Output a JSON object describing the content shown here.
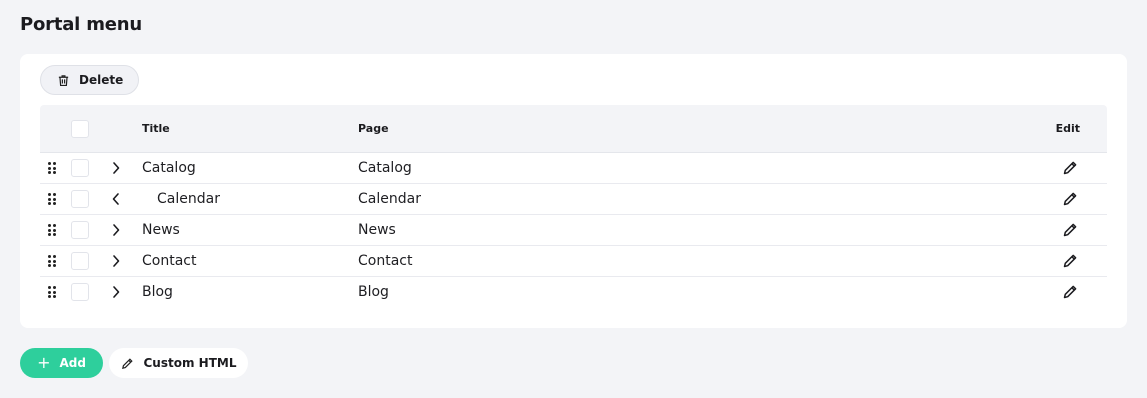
{
  "page": {
    "title": "Portal menu"
  },
  "toolbar": {
    "delete_label": "Delete",
    "delete_icon": "trash-icon"
  },
  "table": {
    "headers": {
      "title": "Title",
      "page": "Page",
      "edit": "Edit"
    },
    "rows": [
      {
        "title": "Catalog",
        "page": "Catalog",
        "chevron": "chevron-right-icon",
        "indented": false
      },
      {
        "title": "Calendar",
        "page": "Calendar",
        "chevron": "chevron-left-icon",
        "indented": true
      },
      {
        "title": "News",
        "page": "News",
        "chevron": "chevron-right-icon",
        "indented": false
      },
      {
        "title": "Contact",
        "page": "Contact",
        "chevron": "chevron-right-icon",
        "indented": false
      },
      {
        "title": "Blog",
        "page": "Blog",
        "chevron": "chevron-right-icon",
        "indented": false
      }
    ]
  },
  "footer": {
    "add_label": "Add",
    "add_icon": "plus-icon",
    "custom_html_label": "Custom HTML",
    "custom_html_icon": "pencil-icon"
  },
  "colors": {
    "accent": "#2ecf9c",
    "background": "#f3f4f7",
    "card": "#ffffff"
  }
}
